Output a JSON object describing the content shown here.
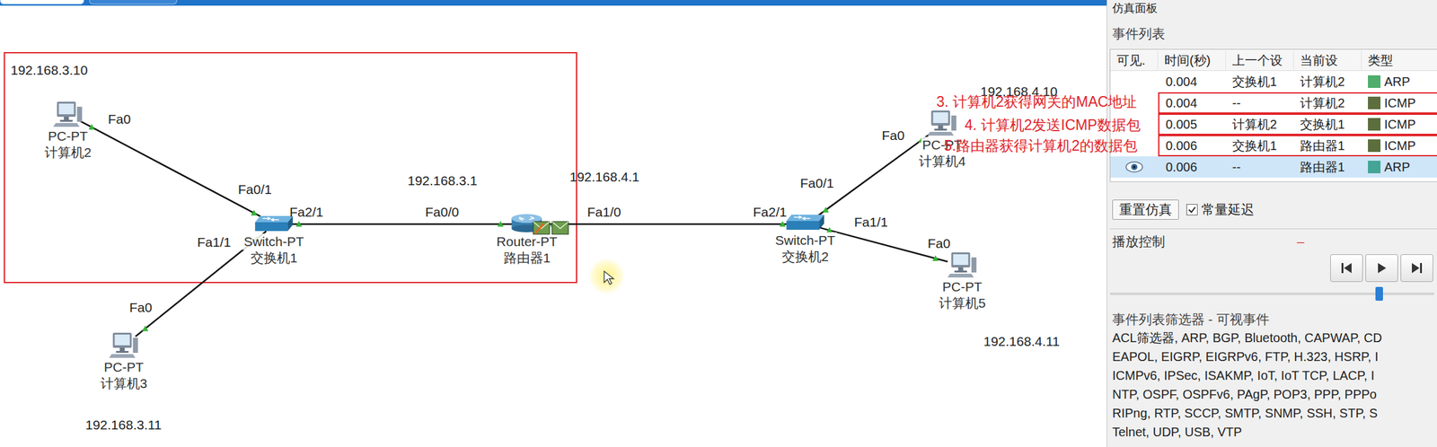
{
  "network": {
    "devices": [
      {
        "model": "PC-PT",
        "name": "计算机2",
        "kind": "pc"
      },
      {
        "model": "PC-PT",
        "name": "计算机3",
        "kind": "pc"
      },
      {
        "model": "Switch-PT",
        "name": "交换机1",
        "kind": "switch"
      },
      {
        "model": "Router-PT",
        "name": "路由器1",
        "kind": "router"
      },
      {
        "model": "Switch-PT",
        "name": "交换机2",
        "kind": "switch"
      },
      {
        "model": "PC-PT",
        "name": "计算机4",
        "kind": "pc"
      },
      {
        "model": "PC-PT",
        "name": "计算机5",
        "kind": "pc"
      }
    ],
    "addresses": [
      "192.168.3.10",
      "192.168.3.11",
      "192.168.3.1",
      "192.168.4.1",
      "192.168.4.10",
      "192.168.4.11"
    ],
    "ports": [
      "Fa0",
      "Fa0/1",
      "Fa2/1",
      "Fa1/1",
      "Fa0",
      "Fa0/0",
      "Fa1/0",
      "Fa2/1",
      "Fa0/1",
      "Fa1/1",
      "Fa0",
      "Fa0"
    ],
    "packets": [
      {
        "failed": true
      },
      {
        "failed": false
      }
    ]
  },
  "annotations": [
    "3. 计算机2获得网关的MAC地址",
    "4. 计算机2发送ICMP数据包",
    "5.路由器获得计算机2的数据包"
  ],
  "panel": {
    "title": "仿真面板",
    "event_list_label": "事件列表",
    "columns": [
      "可见.",
      "时间(秒)",
      "上一个设",
      "当前设",
      "类型"
    ],
    "events": [
      {
        "visible": false,
        "time": "0.004",
        "last": "交换机1",
        "current": "计算机2",
        "type": "ARP",
        "color": "#4fae6b",
        "selected": false,
        "marked": false
      },
      {
        "visible": false,
        "time": "0.004",
        "last": "--",
        "current": "计算机2",
        "type": "ICMP",
        "color": "#5b6e3c",
        "selected": false,
        "marked": true
      },
      {
        "visible": false,
        "time": "0.005",
        "last": "计算机2",
        "current": "交换机1",
        "type": "ICMP",
        "color": "#5b6e3c",
        "selected": false,
        "marked": true
      },
      {
        "visible": false,
        "time": "0.006",
        "last": "交换机1",
        "current": "路由器1",
        "type": "ICMP",
        "color": "#5b6e3c",
        "selected": false,
        "marked": true
      },
      {
        "visible": true,
        "time": "0.006",
        "last": "--",
        "current": "路由器1",
        "type": "ARP",
        "color": "#43a596",
        "selected": true,
        "marked": false
      }
    ],
    "reset_button": "重置仿真",
    "constant_delay": {
      "label": "常量延迟",
      "checked": true
    },
    "playback": {
      "label": "播放控制",
      "indicator": "–",
      "level": 0.83
    },
    "filter": {
      "title": "事件列表筛选器 - 可视事件",
      "lines": [
        "ACL筛选器, ARP, BGP, Bluetooth, CAPWAP, CD",
        "EAPOL, EIGRP, EIGRPv6, FTP, H.323, HSRP, I",
        "ICMPv6, IPSec, ISAKMP, IoT, IoT TCP, LACP, I",
        "NTP, OSPF, OSPFv6, PAgP, POP3, PPP, PPPo",
        "RIPng, RTP, SCCP, SMTP, SNMP, SSH, STP, S",
        "Telnet, UDP, USB, VTP"
      ]
    }
  }
}
